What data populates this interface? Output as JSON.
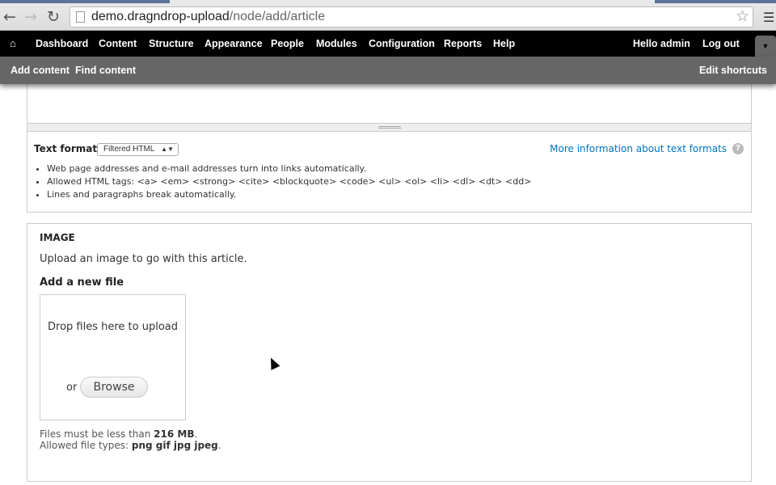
{
  "browser": {
    "url_host": "demo.dragndrop-upload",
    "url_path": "/node/add/article"
  },
  "toolbar": {
    "items": [
      "Dashboard",
      "Content",
      "Structure",
      "Appearance",
      "People",
      "Modules",
      "Configuration",
      "Reports",
      "Help"
    ],
    "hello": "Hello ",
    "user": "admin",
    "logout": "Log out"
  },
  "shortcuts": {
    "add": "Add content",
    "find": "Find content",
    "edit": "Edit shortcuts"
  },
  "text_format": {
    "label": "Text format",
    "selected": "Filtered HTML",
    "more": "More information about text formats",
    "tips": [
      "Web page addresses and e-mail addresses turn into links automatically.",
      "Allowed HTML tags: <a> <em> <strong> <cite> <blockquote> <code> <ul> <ol> <li> <dl> <dt> <dd>",
      "Lines and paragraphs break automatically."
    ]
  },
  "image": {
    "title": "IMAGE",
    "description": "Upload an image to go with this article.",
    "add_label": "Add a new file",
    "drop_text": "Drop files here to upload",
    "or": "or",
    "browse": "Browse",
    "size_prefix": "Files must be less than ",
    "size": "216 MB",
    "types_prefix": "Allowed file types: ",
    "types": "png gif jpg jpeg"
  }
}
